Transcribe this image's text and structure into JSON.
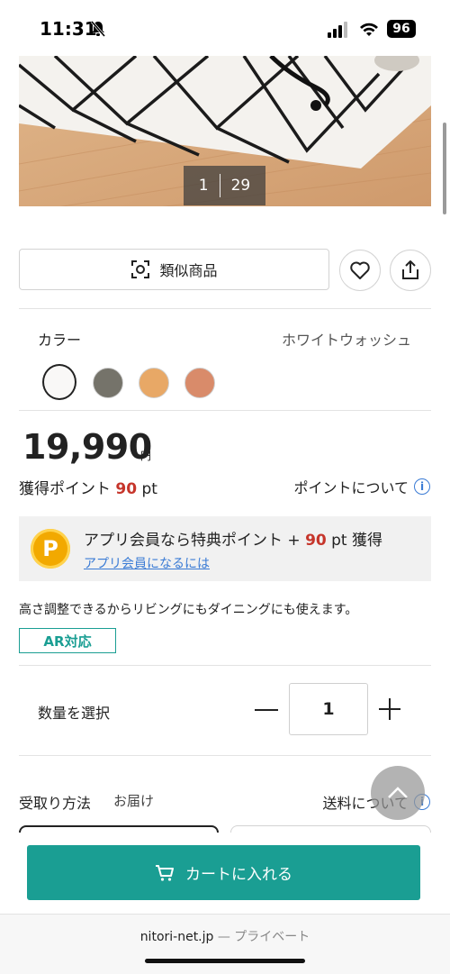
{
  "status_bar": {
    "time": "11:31",
    "battery": "96"
  },
  "gallery": {
    "current": "1",
    "total": "29"
  },
  "actions": {
    "similar_label": "類似商品"
  },
  "color": {
    "label": "カラー",
    "selected_name": "ホワイトウォッシュ",
    "swatches": [
      "#f9f8f7",
      "#75736a",
      "#e8a866",
      "#d98b6a"
    ]
  },
  "price": {
    "amount": "19,990",
    "currency": "円"
  },
  "points": {
    "label": "獲得ポイント",
    "value": "90",
    "unit": "pt",
    "about_label": "ポイントについて"
  },
  "app_banner": {
    "icon_letter": "P",
    "text_before": "アプリ会員なら特典ポイント +",
    "value": "90",
    "text_after": "pt 獲得",
    "link": "アプリ会員になるには"
  },
  "description": "高さ調整できるからリビングにもダイニングにも使えます。",
  "ar_badge": "AR対応",
  "quantity": {
    "label": "数量を選択",
    "value": "1"
  },
  "delivery": {
    "label": "受取り方法",
    "value": "お届け",
    "shipping_label": "送料について"
  },
  "cart": {
    "button_label": "カートに入れる"
  },
  "browser": {
    "domain": "nitori-net.jp",
    "mode": "— プライベート"
  },
  "colors": {
    "accent": "#1a9e93",
    "point_red": "#c6352b",
    "link_blue": "#3a7bd5"
  }
}
